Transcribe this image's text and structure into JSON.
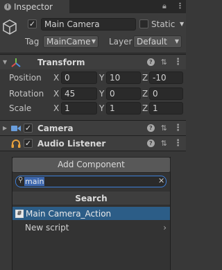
{
  "tab": {
    "title": "Inspector"
  },
  "object": {
    "active": true,
    "name": "Main Camera",
    "static_label": "Static",
    "static_checked": false,
    "tag_label": "Tag",
    "tag_value": "MainCame",
    "layer_label": "Layer",
    "layer_value": "Default"
  },
  "transform": {
    "title": "Transform",
    "rows": [
      {
        "label": "Position",
        "x": "0",
        "y": "10",
        "z": "-10"
      },
      {
        "label": "Rotation",
        "x": "45",
        "y": "0",
        "z": "0"
      },
      {
        "label": "Scale",
        "x": "1",
        "y": "1",
        "z": "1"
      }
    ],
    "axes": {
      "x": "X",
      "y": "Y",
      "z": "Z"
    }
  },
  "components": [
    {
      "title": "Camera",
      "enabled": true
    },
    {
      "title": "Audio Listener",
      "enabled": true
    }
  ],
  "add_component": {
    "button_label": "Add Component",
    "search_value": "main",
    "section_title": "Search",
    "results": [
      {
        "label": "Main Camera_Action",
        "selected": true,
        "icon": "script-icon"
      },
      {
        "label": "New script",
        "selected": false,
        "has_submenu": true
      }
    ]
  },
  "icons": {
    "lock": "lock-icon",
    "menu": "kebab-menu-icon",
    "transform": "transform-axes-icon",
    "camera": "camera-icon",
    "audio": "headphones-icon",
    "gameobject": "cube-icon",
    "help": "help-icon",
    "presets": "presets-icon",
    "search": "search-icon",
    "clear": "clear-icon"
  },
  "colors": {
    "background": "#383838",
    "selection": "#2c5d87",
    "search_focus": "#3e7fd8",
    "transform_red": "#e0514a",
    "transform_green": "#74c34f",
    "transform_blue": "#4f8ee0",
    "audio_orange": "#e6a03c",
    "camera_blue": "#6a9edc"
  }
}
